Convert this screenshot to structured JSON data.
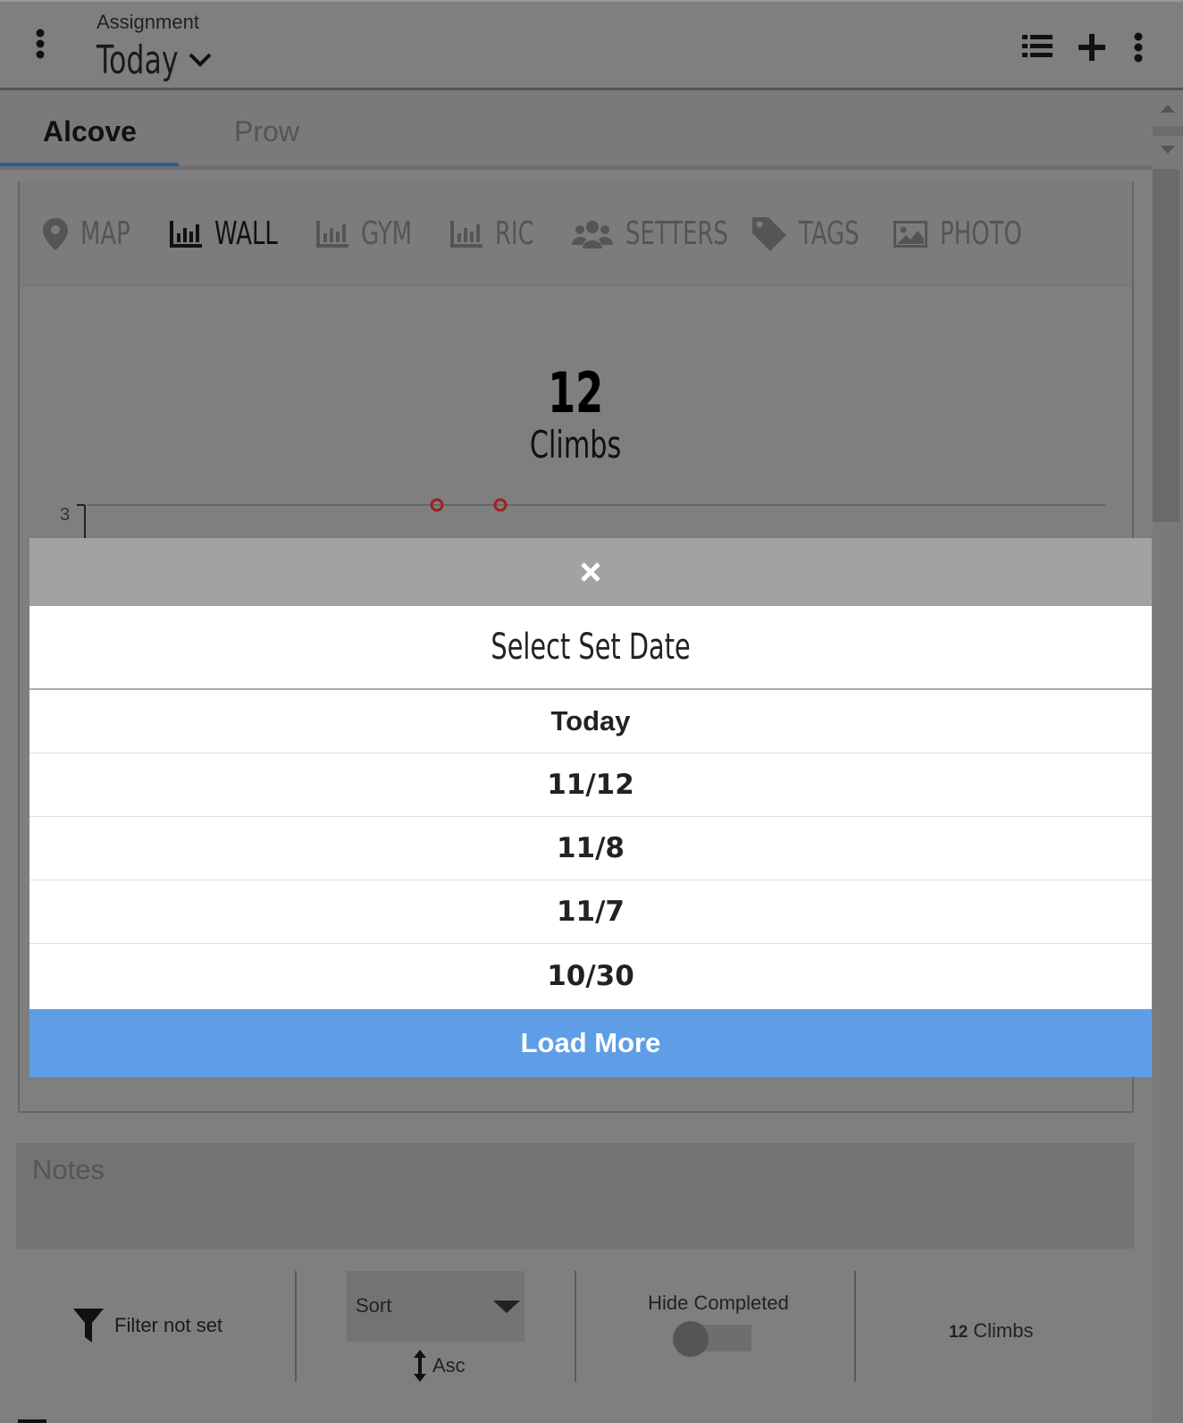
{
  "header": {
    "label": "Assignment",
    "value": "Today",
    "icons": [
      "more-vert-icon",
      "chevron-down-icon",
      "list-icon",
      "plus-icon",
      "more-vert-icon"
    ]
  },
  "tabs": [
    {
      "label": "Alcove",
      "active": true
    },
    {
      "label": "Prow",
      "active": false
    }
  ],
  "toolbar": [
    {
      "label": "MAP",
      "icon": "map-marker-icon"
    },
    {
      "label": "WALL",
      "icon": "bar-chart-icon",
      "active": true
    },
    {
      "label": "GYM",
      "icon": "bar-chart-icon"
    },
    {
      "label": "RIC",
      "icon": "bar-chart-icon"
    },
    {
      "label": "SETTERS",
      "icon": "users-icon"
    },
    {
      "label": "TAGS",
      "icon": "tag-icon"
    },
    {
      "label": "PHOTO",
      "icon": "image-icon"
    }
  ],
  "summary": {
    "count": "12",
    "label": "Climbs"
  },
  "chart": {
    "y_tick": "3"
  },
  "modal": {
    "title": "Select Set Date",
    "options": [
      "Today",
      "11/12",
      "11/8",
      "11/7",
      "10/30"
    ],
    "load_more": "Load More",
    "accent": "#5f9ee6"
  },
  "notes": {
    "placeholder": "Notes"
  },
  "footer": {
    "filter": "Filter not set",
    "sort": "Sort",
    "order": "Asc",
    "hide_completed": "Hide Completed",
    "hide_completed_on": false,
    "count": "12",
    "count_label": "Climbs"
  }
}
